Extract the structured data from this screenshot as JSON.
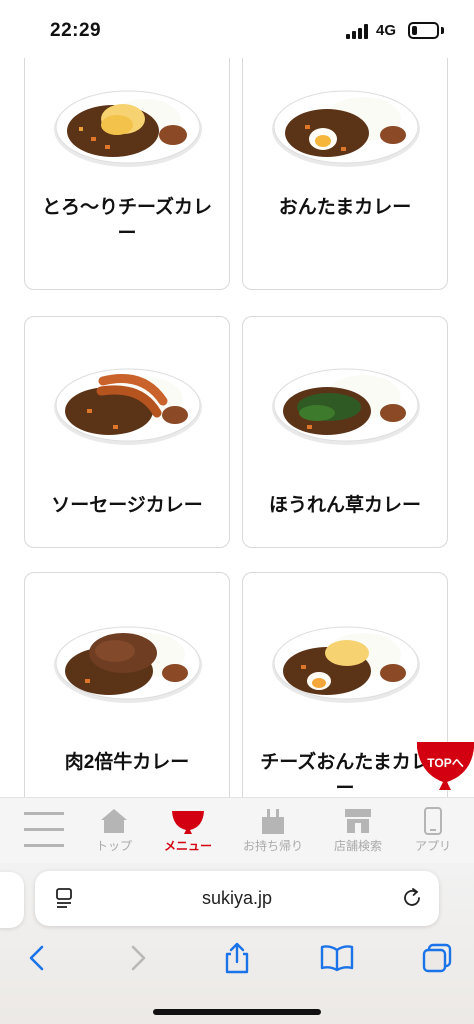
{
  "status_bar": {
    "time": "22:29",
    "network": "4G"
  },
  "menu_items": [
    {
      "name": "とろ〜りチーズカレー",
      "topping": "cheese"
    },
    {
      "name": "おんたまカレー",
      "topping": "egg"
    },
    {
      "name": "ソーセージカレー",
      "topping": "sausage"
    },
    {
      "name": "ほうれん草カレー",
      "topping": "spinach"
    },
    {
      "name": "肉2倍牛カレー",
      "topping": "beef"
    },
    {
      "name": "チーズおんたまカレー",
      "topping": "cheese-egg"
    }
  ],
  "top_button": {
    "label": "TOPへ"
  },
  "app_nav": {
    "items": [
      {
        "label": "",
        "icon": "hamburger-icon"
      },
      {
        "label": "トップ",
        "icon": "house-icon"
      },
      {
        "label": "メニュー",
        "icon": "bowl-icon",
        "active": true
      },
      {
        "label": "お持ち帰り",
        "icon": "takeout-bag-icon"
      },
      {
        "label": "店舗検索",
        "icon": "store-icon"
      },
      {
        "label": "アプリ",
        "icon": "smartphone-icon"
      }
    ]
  },
  "browser": {
    "url": "sukiya.jp"
  },
  "colors": {
    "accent": "#d20010",
    "safari_blue": "#1a73e8",
    "curry": "#5b3418",
    "rice": "#ffffff"
  }
}
